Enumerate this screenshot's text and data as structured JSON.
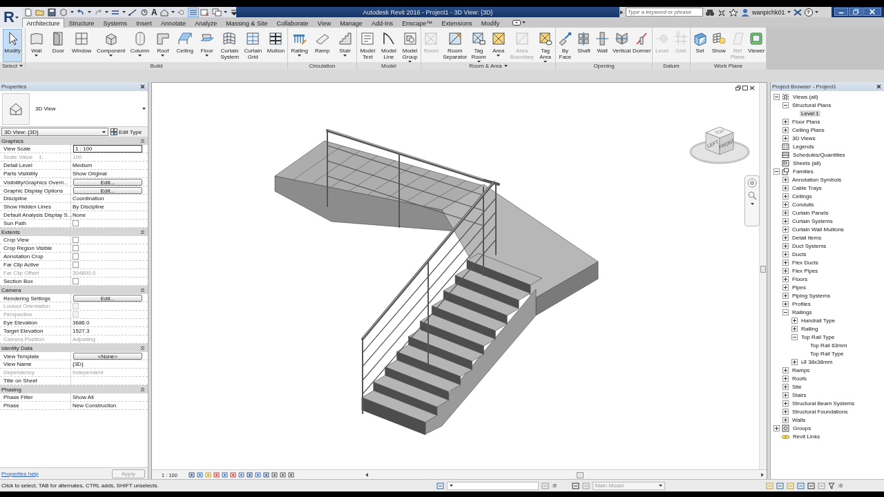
{
  "app_menu": {
    "label": "R"
  },
  "quick_access": {
    "text_tool": "A"
  },
  "window": {
    "title": "Autodesk Revit 2016 - Project1 - 3D View: {3D}"
  },
  "search": {
    "placeholder": "Type a keyword or phrase"
  },
  "user": {
    "name": "wanpichk01"
  },
  "help": {
    "label": "?"
  },
  "tabs": [
    {
      "label": "Architecture",
      "selected": true
    },
    {
      "label": "Structure",
      "selected": false
    },
    {
      "label": "Systems",
      "selected": false
    },
    {
      "label": "Insert",
      "selected": false
    },
    {
      "label": "Annotate",
      "selected": false
    },
    {
      "label": "Analyze",
      "selected": false
    },
    {
      "label": "Massing & Site",
      "selected": false
    },
    {
      "label": "Collaborate",
      "selected": false
    },
    {
      "label": "View",
      "selected": false
    },
    {
      "label": "Manage",
      "selected": false
    },
    {
      "label": "Add-Ins",
      "selected": false
    },
    {
      "label": "Enscape™",
      "selected": false
    },
    {
      "label": "Extensions",
      "selected": false
    },
    {
      "label": "Modify",
      "selected": false
    }
  ],
  "ribbon": {
    "panels": [
      {
        "label": "Select",
        "menu": true,
        "buttons": [
          {
            "label": "Modify",
            "selected": true,
            "disabled": false,
            "dropdown": false
          }
        ]
      },
      {
        "label": "Build",
        "menu": false,
        "buttons": [
          {
            "label": "Wall",
            "selected": false,
            "disabled": false,
            "dropdown": true
          },
          {
            "label": "Door",
            "selected": false,
            "disabled": false,
            "dropdown": false
          },
          {
            "label": "Window",
            "selected": false,
            "disabled": false,
            "dropdown": false
          },
          {
            "label": "Component",
            "selected": false,
            "disabled": false,
            "dropdown": true
          },
          {
            "label": "Column",
            "selected": false,
            "disabled": false,
            "dropdown": true
          },
          {
            "label": "Roof",
            "selected": false,
            "disabled": false,
            "dropdown": true
          },
          {
            "label": "Ceiling",
            "selected": false,
            "disabled": false,
            "dropdown": false
          },
          {
            "label": "Floor",
            "selected": false,
            "disabled": false,
            "dropdown": true
          },
          {
            "label": "Curtain\nSystem",
            "selected": false,
            "disabled": false,
            "dropdown": false
          },
          {
            "label": "Curtain\nGrid",
            "selected": false,
            "disabled": false,
            "dropdown": false
          },
          {
            "label": "Mullion",
            "selected": false,
            "disabled": false,
            "dropdown": false
          }
        ]
      },
      {
        "label": "Circulation",
        "menu": false,
        "buttons": [
          {
            "label": "Railing",
            "selected": false,
            "disabled": false,
            "dropdown": true
          },
          {
            "label": "Ramp",
            "selected": false,
            "disabled": false,
            "dropdown": false
          },
          {
            "label": "Stair",
            "selected": false,
            "disabled": false,
            "dropdown": true
          }
        ]
      },
      {
        "label": "Model",
        "menu": false,
        "buttons": [
          {
            "label": "Model\nText",
            "selected": false,
            "disabled": false,
            "dropdown": false
          },
          {
            "label": "Model\nLine",
            "selected": false,
            "disabled": false,
            "dropdown": false
          },
          {
            "label": "Model\nGroup",
            "selected": false,
            "disabled": false,
            "dropdown": true
          }
        ]
      },
      {
        "label": "Room & Area",
        "menu": true,
        "buttons": [
          {
            "label": "Room",
            "selected": false,
            "disabled": true,
            "dropdown": false
          },
          {
            "label": "Room\nSeparator",
            "selected": false,
            "disabled": false,
            "dropdown": false
          },
          {
            "label": "Tag\nRoom",
            "selected": false,
            "disabled": false,
            "dropdown": true
          },
          {
            "label": "Area",
            "selected": false,
            "disabled": false,
            "dropdown": true
          },
          {
            "label": "Area\nBoundary",
            "selected": false,
            "disabled": true,
            "dropdown": false
          },
          {
            "label": "Tag\nArea",
            "selected": false,
            "disabled": false,
            "dropdown": true
          }
        ]
      },
      {
        "label": "Opening",
        "menu": false,
        "buttons": [
          {
            "label": "By\nFace",
            "selected": false,
            "disabled": false,
            "dropdown": false
          },
          {
            "label": "Shaft",
            "selected": false,
            "disabled": false,
            "dropdown": false
          },
          {
            "label": "Wall",
            "selected": false,
            "disabled": false,
            "dropdown": false
          },
          {
            "label": "Vertical",
            "selected": false,
            "disabled": false,
            "dropdown": false
          },
          {
            "label": "Dormer",
            "selected": false,
            "disabled": false,
            "dropdown": false
          }
        ]
      },
      {
        "label": "Datum",
        "menu": false,
        "buttons": [
          {
            "label": "Level",
            "selected": false,
            "disabled": true,
            "dropdown": false
          },
          {
            "label": "Grid",
            "selected": false,
            "disabled": true,
            "dropdown": false
          }
        ]
      },
      {
        "label": "Work Plane",
        "menu": false,
        "buttons": [
          {
            "label": "Set",
            "selected": false,
            "disabled": false,
            "dropdown": false
          },
          {
            "label": "Show",
            "selected": false,
            "disabled": false,
            "dropdown": false
          },
          {
            "label": "Ref\nPlane",
            "selected": false,
            "disabled": true,
            "dropdown": false
          },
          {
            "label": "Viewer",
            "selected": false,
            "disabled": false,
            "dropdown": false
          }
        ]
      }
    ]
  },
  "properties": {
    "title": "Properties",
    "type_name": "3D View",
    "instance": "3D View: {3D}",
    "edit_type": "Edit Type",
    "sections": [
      {
        "title": "Graphics",
        "expanded": true,
        "rows": [
          {
            "label": "View Scale",
            "kind": "input",
            "value": "1 : 100",
            "disabled": false
          },
          {
            "label": "Scale Value    1:",
            "kind": "text",
            "value": "100",
            "disabled": true
          },
          {
            "label": "Detail Level",
            "kind": "text",
            "value": "Medium",
            "disabled": false
          },
          {
            "label": "Parts Visibility",
            "kind": "text",
            "value": "Show Original",
            "disabled": false
          },
          {
            "label": "Visibility/Graphics Overri...",
            "kind": "button",
            "value": "Edit...",
            "disabled": false
          },
          {
            "label": "Graphic Display Options",
            "kind": "button",
            "value": "Edit...",
            "disabled": false
          },
          {
            "label": "Discipline",
            "kind": "text",
            "value": "Coordination",
            "disabled": false
          },
          {
            "label": "Show Hidden Lines",
            "kind": "text",
            "value": "By Discipline",
            "disabled": false
          },
          {
            "label": "Default Analysis Display S...",
            "kind": "text",
            "value": "None",
            "disabled": false
          },
          {
            "label": "Sun Path",
            "kind": "checkbox",
            "checked": false,
            "disabled": false
          }
        ]
      },
      {
        "title": "Extents",
        "expanded": true,
        "rows": [
          {
            "label": "Crop View",
            "kind": "checkbox",
            "checked": false,
            "disabled": false
          },
          {
            "label": "Crop Region Visible",
            "kind": "checkbox",
            "checked": false,
            "disabled": false
          },
          {
            "label": "Annotation Crop",
            "kind": "checkbox",
            "checked": false,
            "disabled": false
          },
          {
            "label": "Far Clip Active",
            "kind": "checkbox",
            "checked": false,
            "disabled": false
          },
          {
            "label": "Far Clip Offset",
            "kind": "text",
            "value": "304800.0",
            "disabled": true
          },
          {
            "label": "Section Box",
            "kind": "checkbox",
            "checked": false,
            "disabled": false
          }
        ]
      },
      {
        "title": "Camera",
        "expanded": true,
        "rows": [
          {
            "label": "Rendering Settings",
            "kind": "button",
            "value": "Edit...",
            "disabled": false
          },
          {
            "label": "Locked Orientation",
            "kind": "checkbox",
            "checked": false,
            "disabled": true
          },
          {
            "label": "Perspective",
            "kind": "checkbox",
            "checked": false,
            "disabled": true
          },
          {
            "label": "Eye Elevation",
            "kind": "text",
            "value": "3686.0",
            "disabled": false
          },
          {
            "label": "Target Elevation",
            "kind": "text",
            "value": "1527.3",
            "disabled": false
          },
          {
            "label": "Camera Position",
            "kind": "text",
            "value": "Adjusting",
            "disabled": true
          }
        ]
      },
      {
        "title": "Identity Data",
        "expanded": true,
        "rows": [
          {
            "label": "View Template",
            "kind": "button",
            "value": "<None>",
            "disabled": false
          },
          {
            "label": "View Name",
            "kind": "text",
            "value": "{3D}",
            "disabled": false
          },
          {
            "label": "Dependency",
            "kind": "text",
            "value": "Independent",
            "disabled": true
          },
          {
            "label": "Title on Sheet",
            "kind": "text",
            "value": "",
            "disabled": false
          }
        ]
      },
      {
        "title": "Phasing",
        "expanded": true,
        "rows": [
          {
            "label": "Phase Filter",
            "kind": "text",
            "value": "Show All",
            "disabled": false
          },
          {
            "label": "Phase",
            "kind": "text",
            "value": "New Construction",
            "disabled": false
          }
        ]
      }
    ],
    "help": "Properties help",
    "apply": {
      "label": "Apply",
      "disabled": true
    }
  },
  "view": {
    "scale": "1 : 100",
    "viewcube": {
      "top": "TOP",
      "left": "LEFT",
      "front": "FRONT"
    }
  },
  "browser": {
    "title": "Project Browser - Project1",
    "tree": [
      {
        "label": "Views (all)",
        "kind": "views",
        "expanded": true,
        "selected": false,
        "children": [
          {
            "label": "Structural Plans",
            "expanded": true,
            "selected": false,
            "children": [
              {
                "label": "Level 1",
                "selected": true
              }
            ]
          },
          {
            "label": "Floor Plans",
            "expanded": false,
            "selected": false
          },
          {
            "label": "Ceiling Plans",
            "expanded": false,
            "selected": false
          },
          {
            "label": "3D Views",
            "expanded": false,
            "selected": false
          }
        ]
      },
      {
        "label": "Legends",
        "kind": "legends",
        "selected": false
      },
      {
        "label": "Schedules/Quantities",
        "kind": "schedules",
        "selected": false
      },
      {
        "label": "Sheets (all)",
        "kind": "sheets",
        "selected": false
      },
      {
        "label": "Families",
        "kind": "families",
        "expanded": true,
        "selected": false,
        "children": [
          {
            "label": "Annotation Symbols",
            "expanded": false,
            "selected": false
          },
          {
            "label": "Cable Trays",
            "expanded": false,
            "selected": false
          },
          {
            "label": "Ceilings",
            "expanded": false,
            "selected": false
          },
          {
            "label": "Conduits",
            "expanded": false,
            "selected": false
          },
          {
            "label": "Curtain Panels",
            "expanded": false,
            "selected": false
          },
          {
            "label": "Curtain Systems",
            "expanded": false,
            "selected": false
          },
          {
            "label": "Curtain Wall Mullions",
            "expanded": false,
            "selected": false
          },
          {
            "label": "Detail Items",
            "expanded": false,
            "selected": false
          },
          {
            "label": "Duct Systems",
            "expanded": false,
            "selected": false
          },
          {
            "label": "Ducts",
            "expanded": false,
            "selected": false
          },
          {
            "label": "Flex Ducts",
            "expanded": false,
            "selected": false
          },
          {
            "label": "Flex Pipes",
            "expanded": false,
            "selected": false
          },
          {
            "label": "Floors",
            "expanded": false,
            "selected": false
          },
          {
            "label": "Pipes",
            "expanded": false,
            "selected": false
          },
          {
            "label": "Piping Systems",
            "expanded": false,
            "selected": false
          },
          {
            "label": "Profiles",
            "expanded": false,
            "selected": false
          },
          {
            "label": "Railings",
            "expanded": true,
            "selected": false,
            "children": [
              {
                "label": "Handrail Type",
                "expanded": false,
                "selected": false
              },
              {
                "label": "Railing",
                "expanded": false,
                "selected": false
              },
              {
                "label": "Top Rail Type",
                "expanded": true,
                "selected": false,
                "children": [
                  {
                    "label": "Top Rail 63mm",
                    "selected": false
                  },
                  {
                    "label": "Top Rail Type",
                    "selected": false
                  }
                ]
              },
              {
                "label": "เส 38x38mm",
                "expanded": false,
                "selected": false
              }
            ]
          },
          {
            "label": "Ramps",
            "expanded": false,
            "selected": false
          },
          {
            "label": "Roofs",
            "expanded": false,
            "selected": false
          },
          {
            "label": "Site",
            "expanded": false,
            "selected": false
          },
          {
            "label": "Stairs",
            "expanded": false,
            "selected": false
          },
          {
            "label": "Structural Beam Systems",
            "expanded": false,
            "selected": false
          },
          {
            "label": "Structural Foundations",
            "expanded": false,
            "selected": false
          },
          {
            "label": "Walls",
            "expanded": false,
            "selected": false
          }
        ]
      },
      {
        "label": "Groups",
        "kind": "groups",
        "expanded": false,
        "selected": false
      },
      {
        "label": "Revit Links",
        "kind": "links",
        "selected": false
      }
    ]
  },
  "status_bar": {
    "message": "Click to select, TAB for alternates, CTRL adds, SHIFT unselects.",
    "editable_count": ":0",
    "workset": "Main Model",
    "filter_count": ":0"
  }
}
